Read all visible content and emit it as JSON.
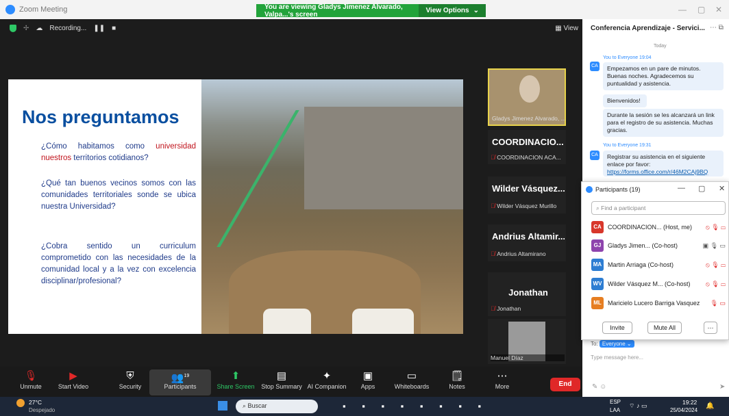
{
  "window": {
    "title": "Zoom Meeting"
  },
  "banner": {
    "text": "You are viewing Gladys Jimenez Alvarado, Valpa...'s screen",
    "view_options": "View Options"
  },
  "recording": {
    "label": "Recording...",
    "pause": "❚❚",
    "stop": "■"
  },
  "view_button": "View",
  "slide": {
    "title": "Nos preguntamos",
    "q1": [
      "¿Cómo habitamos como ",
      "universidad",
      " ",
      "nuestros",
      " territorios cotidianos?"
    ],
    "q2": "¿Qué tan buenos vecinos somos con las comunidades territoriales sonde se ubica nuestra Universidad?",
    "q3": "¿Cobra sentido un curriculum comprometido con las necesidades de la comunidad local y a la vez con excelencia disciplinar/profesional?"
  },
  "thumbs": [
    {
      "name": "",
      "sub": "Gladys Jimenez Alvarado, ..."
    },
    {
      "name": "COORDINACIO...",
      "sub": "COORDINACION ACA..."
    },
    {
      "name": "Wilder Vásquez...",
      "sub": "Wilder Vásquez Murillo"
    },
    {
      "name": "Andrius Altamir...",
      "sub": "Andrius Altamirano"
    },
    {
      "name": "Jonathan",
      "sub": "Jonathan"
    },
    {
      "name": "",
      "sub": "Manuel Díaz"
    }
  ],
  "toolbar": {
    "unmute": "Unmute",
    "video": "Start Video",
    "security": "Security",
    "participants": "Participants",
    "participants_count": "19",
    "share": "Share Screen",
    "summary": "Stop Summary",
    "companion": "AI Companion",
    "apps": "Apps",
    "whiteboards": "Whiteboards",
    "notes": "Notes",
    "more": "More",
    "end": "End"
  },
  "chat": {
    "title": "Conferencia Aprendizaje - Servici...",
    "today": "Today",
    "from1": "You to Everyone 19:04",
    "m1": "Empezamos en un pare de minutos. Buenas noches. Agradecemos su puntualidad y asistencia.",
    "m2": "Bienvenidos!",
    "m3": "Durante la sesión se les alcanzará un link para el registro de su asistencia. Muchas gracias.",
    "from2": "You to Everyone 19:31",
    "m4": "Registrar su asistencia en el siguiente enlace por favor:",
    "m4_link": "https://forms.office.com/r/46M2CAj9BQ",
    "to_label": "To:",
    "to_value": "Everyone",
    "placeholder": "Type message here...",
    "avatar": "CA"
  },
  "participants": {
    "title": "Participants (19)",
    "search": "Find a participant",
    "list": [
      {
        "init": "CA",
        "name": "COORDINACION... (Host, me)",
        "color": "#d8372b"
      },
      {
        "init": "GJ",
        "name": "Gladys Jimen... (Co-host)",
        "color": "#8e44ad"
      },
      {
        "init": "MA",
        "name": "Martin Arriaga (Co-host)",
        "color": "#2d7dd2"
      },
      {
        "init": "WV",
        "name": "Wilder Vásquez M... (Co-host)",
        "color": "#2d7dd2"
      },
      {
        "init": "ML",
        "name": "Maricielo Lucero Barriga Vasquez",
        "color": "#e67e22"
      }
    ],
    "invite": "Invite",
    "mute_all": "Mute All"
  },
  "taskbar": {
    "temp": "27°C",
    "weather": "Despejado",
    "search": "Buscar",
    "lang1": "ESP",
    "lang2": "LAA",
    "time": "19:22",
    "date": "25/04/2024"
  }
}
